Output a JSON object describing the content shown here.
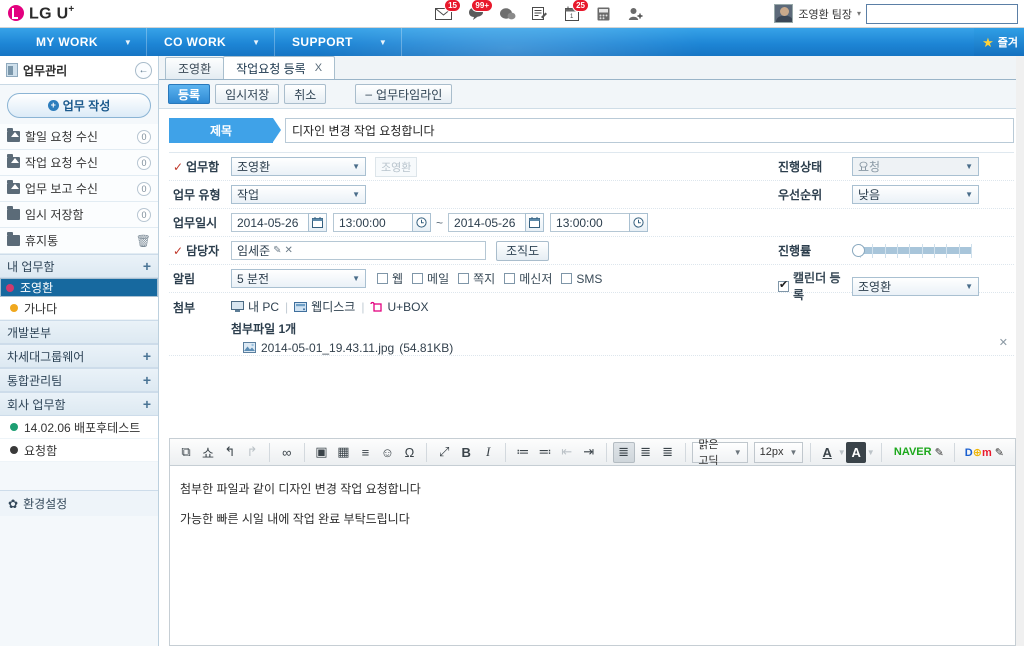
{
  "brand": {
    "name": "LG U",
    "sup": "+",
    "logo_icon": "lg-u-plus-logo"
  },
  "topbar": {
    "icons": [
      {
        "name": "mail-icon",
        "badge": "15"
      },
      {
        "name": "notice-icon",
        "badge": "99+"
      },
      {
        "name": "chat-icon",
        "badge": ""
      },
      {
        "name": "memo-icon",
        "badge": ""
      },
      {
        "name": "calendar-icon",
        "badge": "25"
      },
      {
        "name": "calculator-icon",
        "badge": ""
      },
      {
        "name": "add-contact-icon",
        "badge": ""
      }
    ],
    "user_name": "조영환 팀장",
    "user_caret": "▾",
    "search_value": "",
    "search_placeholder": ""
  },
  "gnb": {
    "items": [
      {
        "label": "MY WORK",
        "caret": "▼"
      },
      {
        "label": "CO WORK",
        "caret": "▼"
      },
      {
        "label": "SUPPORT",
        "caret": "▼"
      }
    ],
    "favorite_label": "즐겨",
    "favorite_icon": "star-icon"
  },
  "sidebar": {
    "header": "업무관리",
    "back_icon": "←",
    "compose_label": "업무 작성",
    "inbox": [
      {
        "label": "할일 요청 수신",
        "count": "0",
        "icon": "folder-in-icon"
      },
      {
        "label": "작업 요청 수신",
        "count": "0",
        "icon": "folder-in-icon"
      },
      {
        "label": "업무 보고 수신",
        "count": "0",
        "icon": "folder-in-icon"
      },
      {
        "label": "임시 저장함",
        "count": "0",
        "icon": "folder-icon"
      }
    ],
    "trash": {
      "label": "휴지통",
      "icon": "trash-icon"
    },
    "groups": [
      {
        "label": "내 업무함",
        "plus": "+",
        "children": [
          {
            "label": "조영환",
            "dot": "#d13a6e",
            "selected": true
          },
          {
            "label": "가나다",
            "dot": "#f0a81e",
            "selected": false
          }
        ]
      },
      {
        "label": "개발본부",
        "plus": "",
        "children": []
      },
      {
        "label": "차세대그룹웨어",
        "plus": "+",
        "children": []
      },
      {
        "label": "통합관리팀",
        "plus": "+",
        "children": []
      },
      {
        "label": "회사 업무함",
        "plus": "+",
        "children": [
          {
            "label": "14.02.06 배포후테스트",
            "dot": "#1d9e72",
            "selected": false
          },
          {
            "label": "요청함",
            "dot": "#3a3a3a",
            "selected": false
          }
        ]
      }
    ],
    "settings": {
      "label": "환경설정",
      "icon": "gear-icon"
    }
  },
  "tabs": [
    {
      "label": "조영환",
      "active": false,
      "closable": false
    },
    {
      "label": "작업요청 등록",
      "active": true,
      "closable": true,
      "close": "X"
    }
  ],
  "commands": {
    "register": "등록",
    "temp_save": "임시저장",
    "cancel": "취소",
    "timeline": "업무타임라인",
    "timeline_prefix": "–"
  },
  "form": {
    "title_label": "제목",
    "title_value": "디자인 변경 작업 요청합니다",
    "workbox": {
      "label": "업무함",
      "required": "✓",
      "value": "조영환",
      "ghost": "조영환"
    },
    "worktype": {
      "label": "업무 유형",
      "value": "작업"
    },
    "schedule": {
      "label": "업무일시",
      "start_date": "2014-05-26",
      "start_time": "13:00:00",
      "tilde": "~",
      "end_date": "2014-05-26",
      "end_time": "13:00:00",
      "date_icon": "calendar-icon",
      "time_icon": "clock-icon"
    },
    "assignee": {
      "label": "담당자",
      "required": "✓",
      "value": "임세준",
      "edit_icon": "✎",
      "remove_icon": "✕",
      "org_button": "조직도"
    },
    "alarm": {
      "label": "알림",
      "value": "5 분전",
      "options": [
        {
          "label": "웹",
          "checked": false
        },
        {
          "label": "메일",
          "checked": false
        },
        {
          "label": "쪽지",
          "checked": false
        },
        {
          "label": "메신저",
          "checked": false
        },
        {
          "label": "SMS",
          "checked": false
        }
      ]
    },
    "status": {
      "label": "진행상태",
      "value": "요청"
    },
    "priority": {
      "label": "우선순위",
      "value": "낮음"
    },
    "progress": {
      "label": "진행률",
      "value": 0
    },
    "calendar_reg": {
      "label": "캘린더 등록",
      "checked": true,
      "value": "조영환"
    },
    "attach": {
      "label": "첨부",
      "sources": [
        {
          "label": "내 PC",
          "icon": "pc-icon"
        },
        {
          "label": "웹디스크",
          "icon": "webdisk-icon"
        },
        {
          "label": "U+BOX",
          "icon": "ubox-icon"
        }
      ],
      "count_label": "첨부파일 1개",
      "files": [
        {
          "name": "2014-05-01_19.43.11.jpg",
          "size": "(54.81KB)",
          "icon": "image-file-icon"
        }
      ],
      "delete_icon": "✕"
    }
  },
  "editor": {
    "tools_left": [
      {
        "name": "source-icon",
        "glyph": "⧉",
        "state": "normal"
      },
      {
        "name": "spellcheck-icon",
        "glyph": "쇼",
        "state": "normal"
      },
      {
        "name": "undo-icon",
        "glyph": "↰",
        "state": "normal"
      },
      {
        "name": "redo-icon",
        "glyph": "↱",
        "state": "off"
      }
    ],
    "tools_link": [
      {
        "name": "link-icon",
        "glyph": "∞",
        "state": "normal"
      }
    ],
    "tools_insert": [
      {
        "name": "image-icon",
        "glyph": "▣",
        "state": "normal"
      },
      {
        "name": "table-icon",
        "glyph": "▦",
        "state": "normal"
      },
      {
        "name": "hr-icon",
        "glyph": "≡",
        "state": "normal"
      },
      {
        "name": "emoticon-icon",
        "glyph": "☺",
        "state": "normal"
      },
      {
        "name": "special-char-icon",
        "glyph": "Ω",
        "state": "normal"
      }
    ],
    "tools_format": [
      {
        "name": "fullscreen-icon",
        "glyph": "⤢",
        "state": "normal"
      },
      {
        "name": "bold-icon",
        "glyph": "B",
        "state": "normal"
      },
      {
        "name": "italic-icon",
        "glyph": "I",
        "state": "normal"
      }
    ],
    "tools_list": [
      {
        "name": "ordered-list-icon",
        "glyph": "≔",
        "state": "normal"
      },
      {
        "name": "bullet-list-icon",
        "glyph": "≕",
        "state": "normal"
      },
      {
        "name": "outdent-icon",
        "glyph": "⇤",
        "state": "off"
      },
      {
        "name": "indent-icon",
        "glyph": "⇥",
        "state": "normal"
      }
    ],
    "tools_align": [
      {
        "name": "align-left-icon",
        "glyph": "≣",
        "state": "on"
      },
      {
        "name": "align-center-icon",
        "glyph": "≣",
        "state": "normal"
      },
      {
        "name": "align-right-icon",
        "glyph": "≣",
        "state": "normal"
      }
    ],
    "font_family": "맑은고딕",
    "font_size": "12px",
    "font_color": {
      "name": "font-color-icon",
      "glyph": "A"
    },
    "bg_color": {
      "name": "background-color-icon",
      "glyph": "A"
    },
    "sites": [
      {
        "label": "NAVER",
        "color": "#1ca81c",
        "icon": "pencil-icon"
      },
      {
        "label": "Daum",
        "icon": "pencil-icon"
      }
    ],
    "body_paragraphs": [
      "첨부한 파일과 같이 디자인 변경 작업 요청합니다",
      "가능한 빠른 시일 내에 작업 완료 부탁드립니다"
    ]
  },
  "colors": {
    "accent": "#1e86d6",
    "brand": "#e3007f",
    "selected_nav": "#17699f",
    "badge": "#e8192c",
    "title_tag": "#3fa2e8"
  }
}
